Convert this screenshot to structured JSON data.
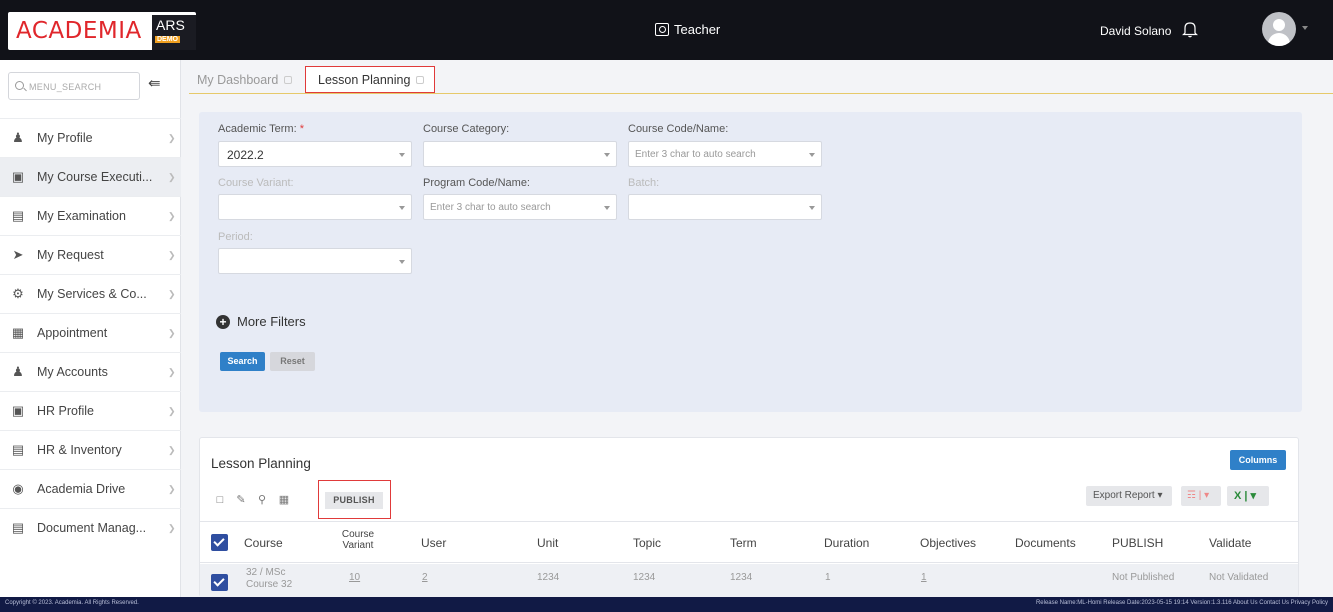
{
  "header": {
    "logo_text": "ACADEMIA",
    "logo_ars": "ARS",
    "logo_badge": "DEMO",
    "role": "Teacher",
    "username": "David Solano"
  },
  "sidebar": {
    "search_placeholder": "MENU_SEARCH",
    "items": [
      {
        "label": "My Profile",
        "icon": "user-icon"
      },
      {
        "label": "My Course Executi...",
        "icon": "course-icon"
      },
      {
        "label": "My Examination",
        "icon": "exam-icon"
      },
      {
        "label": "My Request",
        "icon": "send-icon"
      },
      {
        "label": "My Services & Co...",
        "icon": "services-icon"
      },
      {
        "label": "Appointment",
        "icon": "calendar-icon"
      },
      {
        "label": "My Accounts",
        "icon": "accounts-icon"
      },
      {
        "label": "HR Profile",
        "icon": "hr-profile-icon"
      },
      {
        "label": "HR & Inventory",
        "icon": "hr-inventory-icon"
      },
      {
        "label": "Academia Drive",
        "icon": "drive-icon"
      },
      {
        "label": "Document Manag...",
        "icon": "document-icon"
      }
    ]
  },
  "tabs": [
    {
      "label": "My Dashboard"
    },
    {
      "label": "Lesson Planning"
    }
  ],
  "filters": {
    "academic_term": {
      "label": "Academic Term:",
      "required": "*",
      "value": "2022.2"
    },
    "course_category": {
      "label": "Course Category:",
      "value": ""
    },
    "course_code": {
      "label": "Course Code/Name:",
      "placeholder": "Enter 3 char to auto search"
    },
    "course_variant": {
      "label": "Course Variant:"
    },
    "program_code": {
      "label": "Program Code/Name:",
      "placeholder": "Enter 3 char to auto search"
    },
    "batch": {
      "label": "Batch:"
    },
    "period": {
      "label": "Period:"
    },
    "more_filters": "More Filters",
    "search_btn": "Search",
    "reset_btn": "Reset"
  },
  "lesson_planning": {
    "title": "Lesson Planning",
    "columns_btn": "Columns",
    "publish_btn": "PUBLISH",
    "export_btn": "Export Report",
    "headers": [
      "Course",
      "Course Variant",
      "User",
      "Unit",
      "Topic",
      "Term",
      "Duration",
      "Objectives",
      "Documents",
      "PUBLISH",
      "Validate"
    ],
    "row": {
      "course_line1": "32 / MSc",
      "course_line2": "Course 32",
      "variant": "10",
      "user": "2",
      "unit": "1234",
      "topic": "1234",
      "term": "1234",
      "duration": "1",
      "objectives": "1",
      "documents": "",
      "publish": "Not Published",
      "validate": "Not Validated"
    }
  },
  "footer": {
    "left": "Copyright © 2023. Academia. All Rights Reserved.",
    "right": "Release Name:ML-Homi   Release Date:2023-05-15 19:14   Version:1.3.116   About Us   Contact Us   Privacy Policy"
  }
}
